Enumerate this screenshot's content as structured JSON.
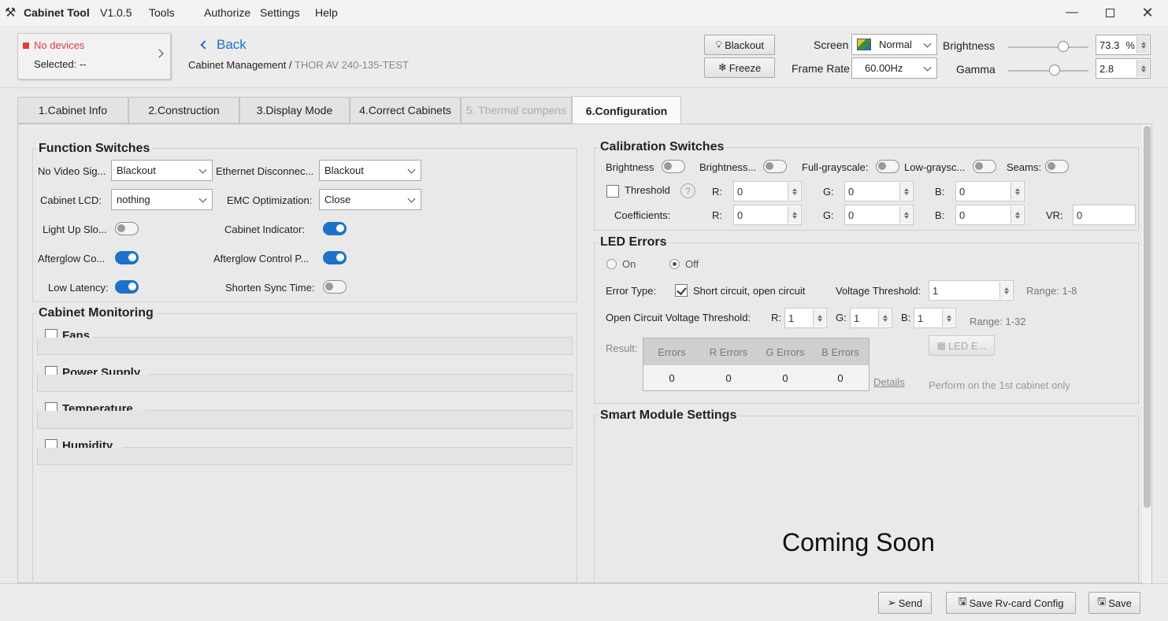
{
  "app": {
    "title": "Cabinet Tool",
    "version": "V1.0.5"
  },
  "menu": [
    "Tools",
    "Authorize",
    "Settings",
    "Help"
  ],
  "device": {
    "status": "No devices",
    "selected": "Selected: --"
  },
  "nav": {
    "back": "Back",
    "breadcrumb_root": "Cabinet Management",
    "breadcrumb_sep": " / ",
    "breadcrumb_current": "THOR AV 240-135-TEST"
  },
  "controls": {
    "blackout": "Blackout",
    "freeze": "Freeze",
    "screen_label": "Screen",
    "screen_value": "Normal",
    "framerate_label": "Frame Rate",
    "framerate_value": "60.00Hz",
    "brightness_label": "Brightness",
    "brightness_value": "73.3",
    "brightness_unit": "%",
    "gamma_label": "Gamma",
    "gamma_value": "2.8"
  },
  "tabs": [
    "1.Cabinet Info",
    "2.Construction",
    "3.Display Mode",
    "4.Correct Cabinets",
    "5. Thermal compens",
    "6.Configuration"
  ],
  "function_switches": {
    "title": "Function Switches",
    "no_video_label": "No Video Sig...",
    "no_video_value": "Blackout",
    "ethernet_label": "Ethernet Disconnec...",
    "ethernet_value": "Blackout",
    "lcd_label": "Cabinet LCD:",
    "lcd_value": "nothing",
    "emc_label": "EMC Optimization:",
    "emc_value": "Close",
    "light_up_label": "Light Up Slo...",
    "cabinet_indicator_label": "Cabinet Indicator:",
    "afterglow_co_label": "Afterglow Co...",
    "afterglow_p_label": "Afterglow Control P...",
    "low_latency_label": "Low Latency:",
    "shorten_sync_label": "Shorten Sync Time:"
  },
  "monitoring": {
    "title": "Cabinet Monitoring",
    "items": [
      "Fans",
      "Power Supply",
      "Temperature",
      "Humidity"
    ]
  },
  "calibration": {
    "title": "Calibration Switches",
    "switches": [
      "Brightness",
      "Brightness...",
      "Full-grayscale:",
      "Low-graysc...",
      "Seams:"
    ],
    "threshold": "Threshold",
    "help": "?",
    "r": "R:",
    "g": "G:",
    "b": "B:",
    "vr": "VR:",
    "coefficients": "Coefficients:",
    "zero": "0"
  },
  "led_errors": {
    "title": "LED Errors",
    "on": "On",
    "off": "Off",
    "error_type_label": "Error Type:",
    "error_type_value": "Short circuit, open circuit",
    "voltage_label": "Voltage Threshold:",
    "voltage_value": "1",
    "voltage_range": "Range: 1-8",
    "open_label": "Open Circuit Voltage Threshold:",
    "r": "R:",
    "g": "G:",
    "b": "B:",
    "open_r": "1",
    "open_g": "1",
    "open_b": "1",
    "open_range": "Range: 1-32",
    "led_e_button": "LED E...",
    "result_label": "Result:",
    "columns": [
      "Errors",
      "R Errors",
      "G Errors",
      "B Errors"
    ],
    "values": [
      "0",
      "0",
      "0",
      "0"
    ],
    "details": "Details",
    "note": "Perform on the 1st cabinet only"
  },
  "smart": {
    "title": "Smart Module Settings",
    "coming": "Coming Soon"
  },
  "footer": {
    "send": "Send",
    "save_rv": "Save Rv-card Config",
    "save": "Save"
  }
}
